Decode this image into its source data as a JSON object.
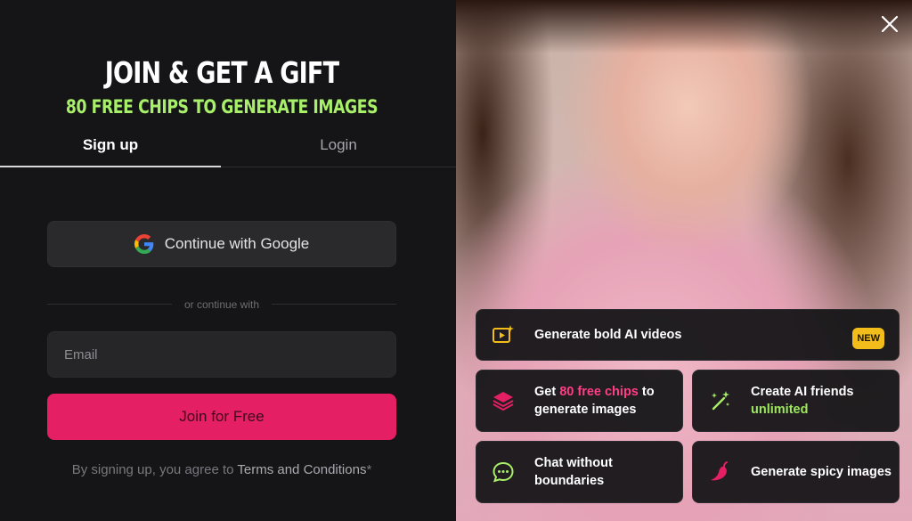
{
  "modal": {
    "headline": "JOIN & GET A GIFT",
    "subheadline": "80 FREE CHIPS TO GENERATE IMAGES",
    "tabs": {
      "signup": "Sign up",
      "login": "Login",
      "active": "signup"
    },
    "google_button": "Continue with Google",
    "divider": "or continue with",
    "email": {
      "placeholder": "Email",
      "value": ""
    },
    "join_button": "Join for Free",
    "terms": {
      "prefix": "By signing up, you agree to ",
      "link": "Terms and Conditions",
      "suffix": "*"
    }
  },
  "features": [
    {
      "text": "Generate bold AI videos",
      "badge": "NEW",
      "icon": "video-sparkle-icon"
    },
    {
      "before": "Get ",
      "highlight": "80 free chips",
      "after": " to generate images",
      "icon": "layers-icon"
    },
    {
      "before": "Create AI friends ",
      "highlight": "unlimited",
      "after": "",
      "icon": "magic-wand-icon"
    },
    {
      "text": "Chat without boundaries",
      "icon": "chat-bubble-icon"
    },
    {
      "text": "Generate spicy images",
      "icon": "chili-pepper-icon"
    }
  ],
  "colors": {
    "accent_pink": "#e41f63",
    "accent_green": "#a8ef6a",
    "badge_yellow": "#f2bd1a"
  }
}
